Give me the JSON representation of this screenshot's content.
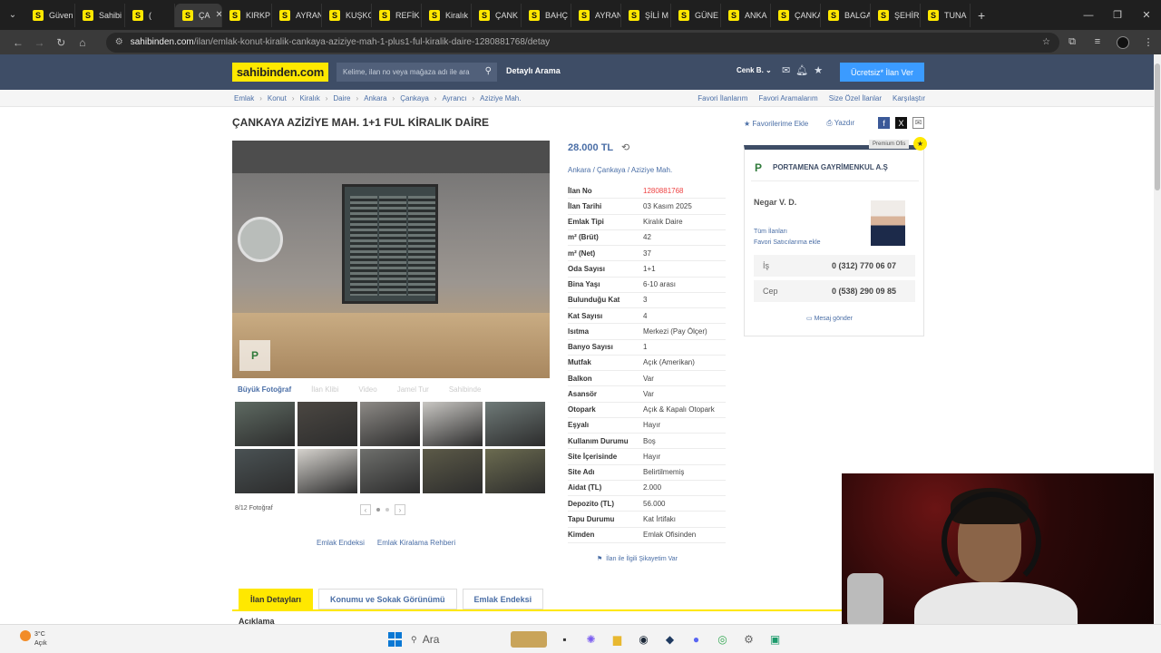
{
  "browser": {
    "tabs": [
      {
        "label": "Güven"
      },
      {
        "label": "Sahibi"
      },
      {
        "label": "("
      },
      {
        "label": "ÇA",
        "active": true
      },
      {
        "label": "KIRKP"
      },
      {
        "label": "AYRAN"
      },
      {
        "label": "KUŞKO"
      },
      {
        "label": "REFİK"
      },
      {
        "label": "Kiralık"
      },
      {
        "label": "ÇANK"
      },
      {
        "label": "BAHÇ"
      },
      {
        "label": "AYRAN"
      },
      {
        "label": "ŞİLİ M"
      },
      {
        "label": "GÜNE"
      },
      {
        "label": "ANKA"
      },
      {
        "label": "ÇANKA"
      },
      {
        "label": "BALGA"
      },
      {
        "label": "ŞEHİR"
      },
      {
        "label": "TUNA"
      }
    ],
    "favicon_letter": "S",
    "url_domain": "sahibinden.com",
    "url_path": "/ilan/emlak-konut-kiralik-cankaya-aziziye-mah-1-plus1-ful-kiralik-daire-1280881768/detay"
  },
  "header": {
    "logo": "sahibinden.com",
    "search_placeholder": "Kelime, ilan no veya mağaza adı ile ara",
    "detail_search": "Detaylı Arama",
    "user": "Cenk B.",
    "post_ad": "Ücretsiz* İlan Ver"
  },
  "breadcrumb": {
    "items": [
      "Emlak",
      "Konut",
      "Kiralık",
      "Daire",
      "Ankara",
      "Çankaya",
      "Ayrancı",
      "Aziziye Mah."
    ],
    "right_links": [
      "Favori İlanlarım",
      "Favori Aramalarım",
      "Size Özel İlanlar",
      "Karşılaştır"
    ]
  },
  "listing": {
    "title": "ÇANKAYA AZİZİYE MAH. 1+1 FUL KİRALIK DAİRE",
    "favorite": "Favorilerime Ekle",
    "print": "Yazdır",
    "price": "28.000 TL",
    "location": "Ankara  /  Çankaya  /  Aziziye Mah.",
    "properties": [
      {
        "k": "İlan No",
        "v": "1280881768",
        "red": true
      },
      {
        "k": "İlan Tarihi",
        "v": "03 Kasım 2025"
      },
      {
        "k": "Emlak Tipi",
        "v": "Kiralık Daire"
      },
      {
        "k": "m² (Brüt)",
        "v": "42"
      },
      {
        "k": "m² (Net)",
        "v": "37"
      },
      {
        "k": "Oda Sayısı",
        "v": "1+1"
      },
      {
        "k": "Bina Yaşı",
        "v": "6-10 arası"
      },
      {
        "k": "Bulunduğu Kat",
        "v": "3"
      },
      {
        "k": "Kat Sayısı",
        "v": "4"
      },
      {
        "k": "Isıtma",
        "v": "Merkezi (Pay Ölçer)"
      },
      {
        "k": "Banyo Sayısı",
        "v": "1"
      },
      {
        "k": "Mutfak",
        "v": "Açık (Amerikan)"
      },
      {
        "k": "Balkon",
        "v": "Var"
      },
      {
        "k": "Asansör",
        "v": "Var"
      },
      {
        "k": "Otopark",
        "v": "Açık & Kapalı Otopark"
      },
      {
        "k": "Eşyalı",
        "v": "Hayır"
      },
      {
        "k": "Kullanım Durumu",
        "v": "Boş"
      },
      {
        "k": "Site İçerisinde",
        "v": "Hayır"
      },
      {
        "k": "Site Adı",
        "v": "Belirtilmemiş"
      },
      {
        "k": "Aidat (TL)",
        "v": "2.000"
      },
      {
        "k": "Depozito (TL)",
        "v": "56.000"
      },
      {
        "k": "Tapu Durumu",
        "v": "Kat İrtifakı"
      },
      {
        "k": "Kimden",
        "v": "Emlak Ofisinden"
      }
    ],
    "complaint": "İlan ile İlgili Şikayetim Var"
  },
  "gallery": {
    "tabs": [
      "Büyük Fotoğraf",
      "İlan Klibi",
      "Video",
      "Jamel Tur",
      "Sahibinde"
    ],
    "counter": "8/12 Fotoğraf",
    "thumb_colors": [
      "#5e6a62",
      "#4b4742",
      "#8d8a86",
      "#c9c7c3",
      "#6f7a78",
      "#4a5254",
      "#d6d3ce",
      "#6e6f6c",
      "#5c5a48",
      "#6b6b50"
    ],
    "links": [
      "Emlak Endeksi",
      "Emlak Kiralama Rehberi"
    ]
  },
  "seller": {
    "premium": "Premium Ofis",
    "agency": "PORTAMENA GAYRİMENKUL A.Ş",
    "agent": "Negar V. D.",
    "all_ads": "Tüm İlanları",
    "fav_seller": "Favori Satıcılarıma ekle",
    "phones": [
      {
        "label": "İş",
        "number": "0 (312) 770 06 07"
      },
      {
        "label": "Cep",
        "number": "0 (538) 290 09 85"
      }
    ],
    "message": "Mesaj gönder"
  },
  "bottom_tabs": [
    "İlan Detayları",
    "Konumu ve Sokak Görünümü",
    "Emlak Endeksi"
  ],
  "description_label": "Açıklama",
  "taskbar": {
    "weather_temp": "3°C",
    "weather_desc": "Açık",
    "search": "Ara"
  }
}
